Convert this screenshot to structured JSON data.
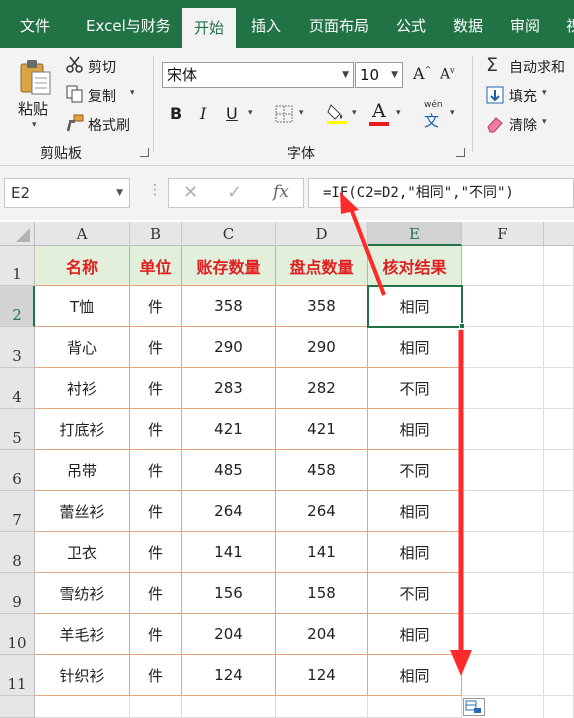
{
  "tabs": [
    "文件",
    "Excel与财务",
    "开始",
    "插入",
    "页面布局",
    "公式",
    "数据",
    "审阅",
    "视"
  ],
  "active_tab": "开始",
  "clipboard": {
    "paste": "粘贴",
    "cut": "剪切",
    "copy": "复制",
    "format_painter": "格式刷",
    "group": "剪贴板"
  },
  "font": {
    "name": "宋体",
    "size": "10",
    "grow": "A",
    "shrink": "A",
    "bold": "B",
    "italic": "I",
    "underline": "U",
    "font_color_glyph": "A",
    "phonetic_top": "wén",
    "phonetic_bottom": "文",
    "group": "字体"
  },
  "editing": {
    "autosum": "自动求和",
    "fill": "填充",
    "clear": "清除"
  },
  "formula_bar": {
    "name_box": "E2",
    "cancel": "✕",
    "enter": "✓",
    "fx": "fx",
    "formula": "=IF(C2=D2,\"相同\",\"不同\")"
  },
  "columns": [
    "A",
    "B",
    "C",
    "D",
    "E",
    "F"
  ],
  "rows": [
    "1",
    "2",
    "3",
    "4",
    "5",
    "6",
    "7",
    "8",
    "9",
    "10",
    "11"
  ],
  "headers": [
    "名称",
    "单位",
    "账存数量",
    "盘点数量",
    "核对结果"
  ],
  "table": [
    [
      "T恤",
      "件",
      "358",
      "358",
      "相同"
    ],
    [
      "背心",
      "件",
      "290",
      "290",
      "相同"
    ],
    [
      "衬衫",
      "件",
      "283",
      "282",
      "不同"
    ],
    [
      "打底衫",
      "件",
      "421",
      "421",
      "相同"
    ],
    [
      "吊带",
      "件",
      "485",
      "458",
      "不同"
    ],
    [
      "蕾丝衫",
      "件",
      "264",
      "264",
      "相同"
    ],
    [
      "卫衣",
      "件",
      "141",
      "141",
      "相同"
    ],
    [
      "雪纺衫",
      "件",
      "156",
      "158",
      "不同"
    ],
    [
      "羊毛衫",
      "件",
      "204",
      "204",
      "相同"
    ],
    [
      "针织衫",
      "件",
      "124",
      "124",
      "相同"
    ]
  ],
  "colors": {
    "excel_green": "#217346",
    "header_fill": "#e2efda",
    "header_text": "#e02020",
    "border": "#e2a77b",
    "arrow": "#ff2a2a"
  }
}
